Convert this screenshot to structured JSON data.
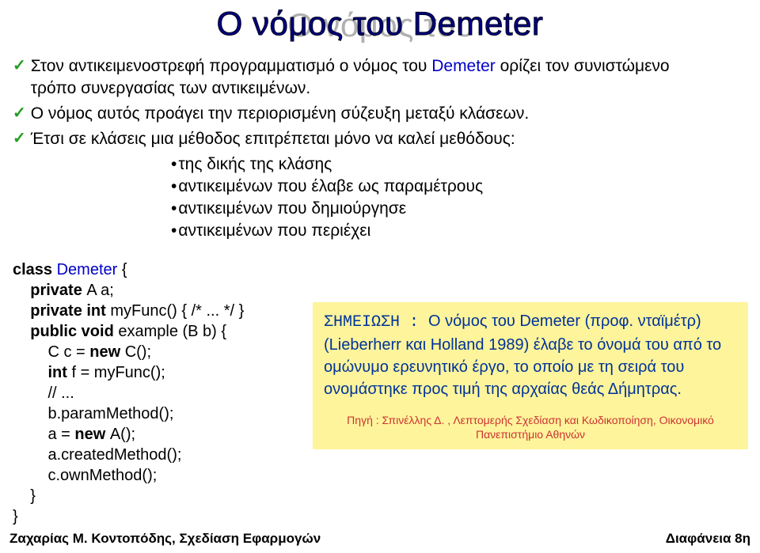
{
  "title": "Ο νόμος του Demeter",
  "bullets": {
    "b1_pre": "Στον αντικειμενοστρεφή προγραμματισμό ο νόμος του ",
    "b1_demeter": "Demeter",
    "b1_post": " ορίζει τον συνιστώμενο τρόπο συνεργασίας των αντικειμένων.",
    "b2": "Ο νόμος αυτός προάγει την περιορισμένη σύζευξη μεταξύ κλάσεων.",
    "b3": "Έτσι σε κλάσεις μια μέθοδος επιτρέπεται μόνο να καλεί μεθόδους:",
    "subs": [
      "της δικής της κλάσης",
      "αντικειμένων που έλαβε ως παραμέτρους",
      "αντικειμένων που δημιούργησε",
      "αντικειμένων που περιέχει"
    ]
  },
  "code": {
    "l01a": "class ",
    "l01b": "Demeter",
    "l01c": " {",
    "l02a": "    private ",
    "l02b": "A a;",
    "l03a": "    private int ",
    "l03b": "myFunc() { /* ... */ }",
    "l04a": "    public void ",
    "l04b": "example (B b) {",
    "l05a": "        C c = ",
    "l05b": "new ",
    "l05c": "C();",
    "l06a": "        int ",
    "l06b": "f = myFunc();",
    "l07": "        // ...",
    "l08": "        b.paramMethod();",
    "l09a": "        a = ",
    "l09b": "new ",
    "l09c": "A();",
    "l10": "        a.createdMethod();",
    "l11": "        c.ownMethod();",
    "l12": "    }",
    "l13": "}"
  },
  "note": {
    "label": "ΣΗΜΕΙΩΣΗ : ",
    "body": "Ο νόμος του Demeter (προφ. νταϊμέτρ) (Lieberherr και Holland 1989) έλαβε το όνομά του από το ομώνυμο ερευνητικό έργο, το οποίο με τη σειρά του ονομάστηκε προς τιμή της αρχαίας θεάς Δήμητρας.",
    "source_prefix": "Πηγή :  ",
    "source": "Σπινέλλης Δ. , Λεπτομερής Σχεδίαση και Κωδικοποίηση, Οικονομικό Πανεπιστήμιο Αθηνών"
  },
  "footer": {
    "left": "Ζαχαρίας Μ. Κοντοπόδης, Σχεδίαση Εφαρμογών",
    "right": "Διαφάνεια 8η"
  }
}
